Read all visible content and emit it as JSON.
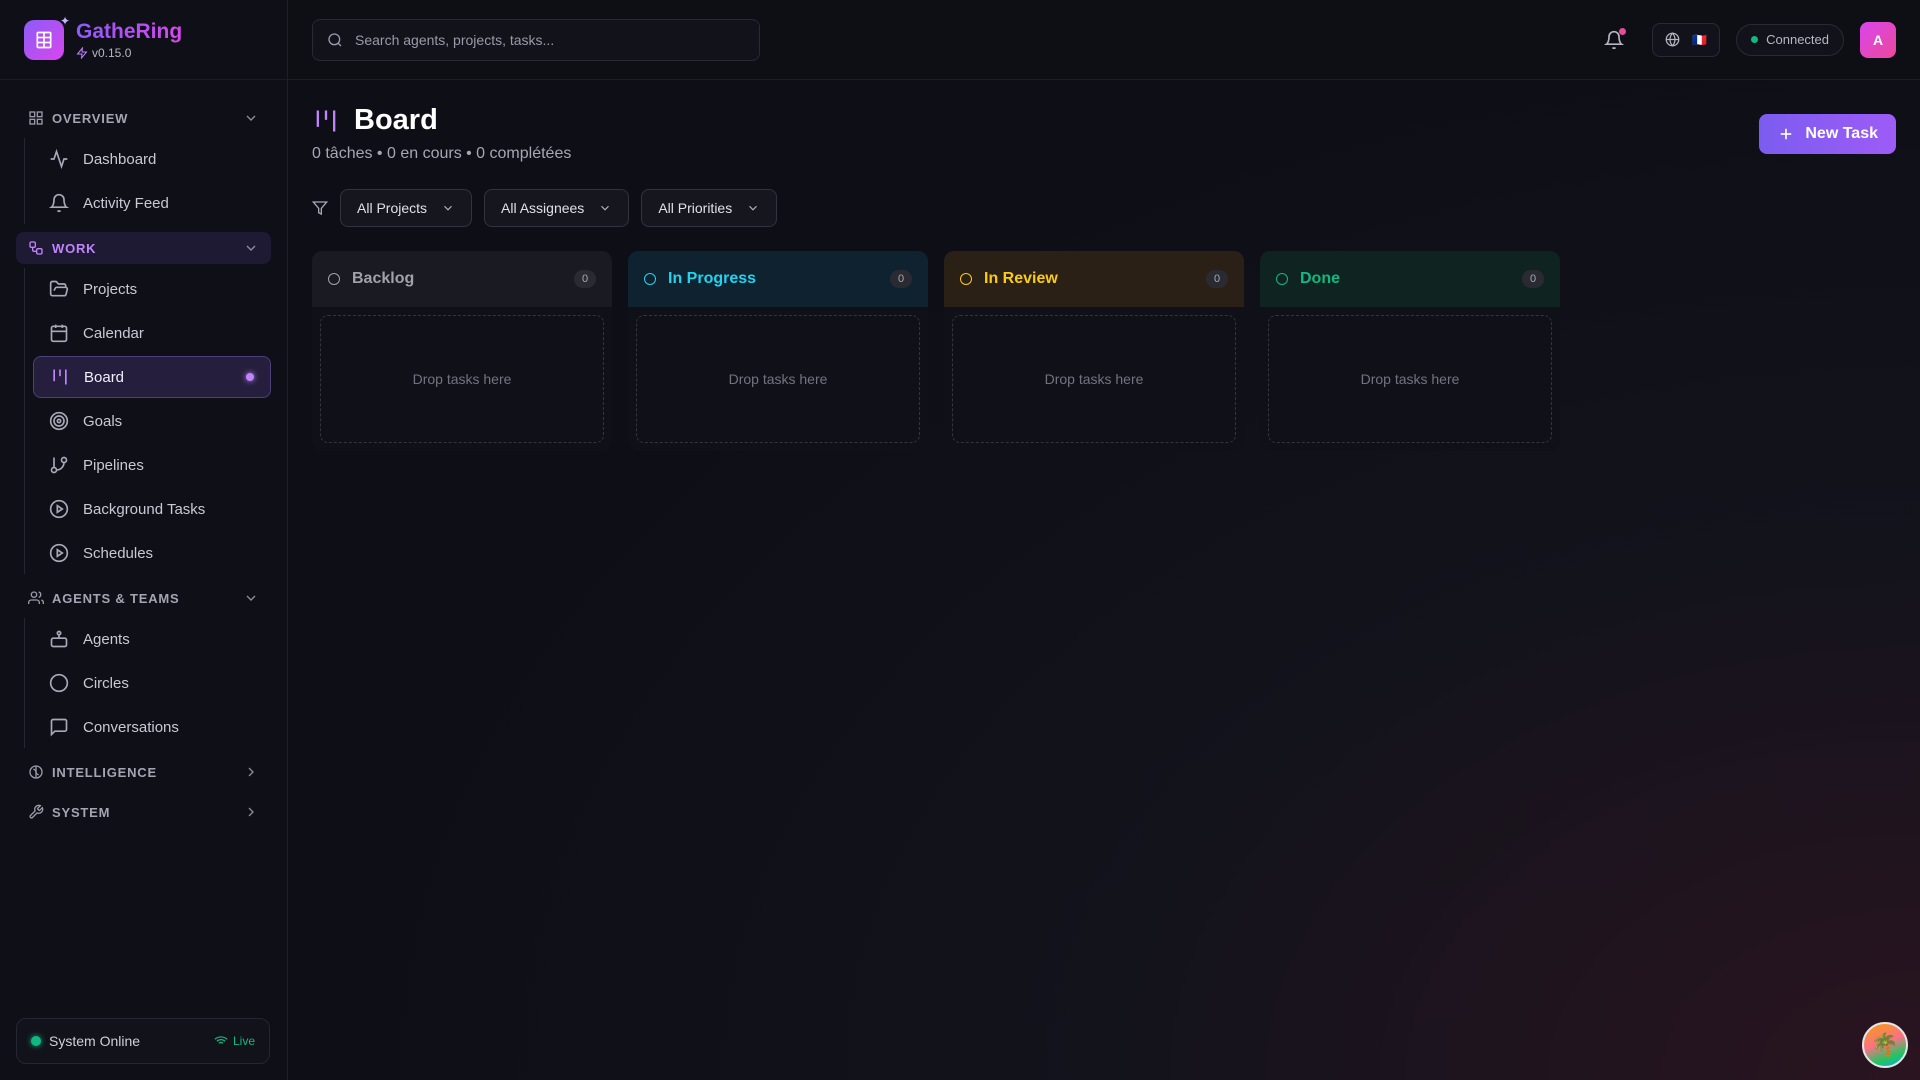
{
  "brand": {
    "name": "GatheRing",
    "version": "v0.15.0"
  },
  "sidebar": {
    "sections": [
      {
        "label": "OVERVIEW",
        "items": [
          {
            "label": "Dashboard"
          },
          {
            "label": "Activity Feed"
          }
        ]
      },
      {
        "label": "WORK",
        "items": [
          {
            "label": "Projects"
          },
          {
            "label": "Calendar"
          },
          {
            "label": "Board"
          },
          {
            "label": "Goals"
          },
          {
            "label": "Pipelines"
          },
          {
            "label": "Background Tasks"
          },
          {
            "label": "Schedules"
          }
        ]
      },
      {
        "label": "AGENTS & TEAMS",
        "items": [
          {
            "label": "Agents"
          },
          {
            "label": "Circles"
          },
          {
            "label": "Conversations"
          }
        ]
      },
      {
        "label": "INTELLIGENCE"
      },
      {
        "label": "SYSTEM"
      }
    ],
    "status": {
      "label": "System Online",
      "live": "Live"
    }
  },
  "topbar": {
    "search_placeholder": "Search agents, projects, tasks...",
    "connection": "Connected",
    "avatar_initial": "A",
    "flag": "🇫🇷"
  },
  "page": {
    "title": "Board",
    "subtitle": "0 tâches • 0 en cours • 0 complétées",
    "new_task_label": "New Task"
  },
  "filters": {
    "projects": "All Projects",
    "assignees": "All Assignees",
    "priorities": "All Priorities"
  },
  "columns": [
    {
      "title": "Backlog",
      "count": "0",
      "empty": "Drop tasks here",
      "color": "#a1a1aa",
      "bg": "#1a1a23"
    },
    {
      "title": "In Progress",
      "count": "0",
      "empty": "Drop tasks here",
      "color": "#22d3ee",
      "bg": "#0f2230"
    },
    {
      "title": "In Review",
      "count": "0",
      "empty": "Drop tasks here",
      "color": "#facc15",
      "bg": "#2a2015"
    },
    {
      "title": "Done",
      "count": "0",
      "empty": "Drop tasks here",
      "color": "#10b981",
      "bg": "#0f2421"
    }
  ],
  "colors": {
    "accent": "#c084fc",
    "online": "#10b981"
  }
}
